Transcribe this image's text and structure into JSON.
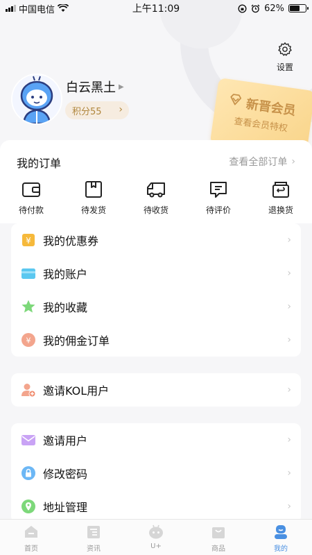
{
  "status_bar": {
    "carrier": "中国电信",
    "time": "上午11:09",
    "battery_text": "62%",
    "battery_level": 0.62
  },
  "header": {
    "settings_label": "设置",
    "username": "白云黑土",
    "points_label": "积分55",
    "vip_title": "新晋会员",
    "vip_subtitle": "查看会员特权"
  },
  "orders": {
    "title": "我的订单",
    "view_all": "查看全部订单",
    "items": [
      {
        "label": "待付款",
        "icon": "wallet-icon"
      },
      {
        "label": "待发货",
        "icon": "package-icon"
      },
      {
        "label": "待收货",
        "icon": "truck-icon"
      },
      {
        "label": "待评价",
        "icon": "comment-icon"
      },
      {
        "label": "退换货",
        "icon": "return-box-icon"
      }
    ]
  },
  "menu_group_1": [
    {
      "label": "我的优惠券",
      "icon": "coupon-icon",
      "color": "#f6b93b"
    },
    {
      "label": "我的账户",
      "icon": "card-icon",
      "color": "#5bc8f0"
    },
    {
      "label": "我的收藏",
      "icon": "star-icon",
      "color": "#7dd87a"
    },
    {
      "label": "我的佣金订单",
      "icon": "commission-icon",
      "color": "#f3a58d"
    }
  ],
  "menu_group_2": [
    {
      "label": "邀请KOL用户",
      "icon": "invite-kol-icon",
      "color": "#f3a58d"
    }
  ],
  "menu_group_3": [
    {
      "label": "邀请用户",
      "icon": "envelope-icon",
      "color": "#c9a3f5"
    },
    {
      "label": "修改密码",
      "icon": "lock-icon",
      "color": "#6cb7f5"
    },
    {
      "label": "地址管理",
      "icon": "location-icon",
      "color": "#7dd87a"
    }
  ],
  "tabbar": [
    {
      "label": "首页",
      "icon": "home-icon",
      "active": false
    },
    {
      "label": "资讯",
      "icon": "news-icon",
      "active": false
    },
    {
      "label": "U+",
      "icon": "robot-icon",
      "active": false
    },
    {
      "label": "商品",
      "icon": "bag-icon",
      "active": false
    },
    {
      "label": "我的",
      "icon": "profile-icon",
      "active": true
    }
  ],
  "colors": {
    "accent": "#4a90e2",
    "gold": "#c7924a"
  }
}
